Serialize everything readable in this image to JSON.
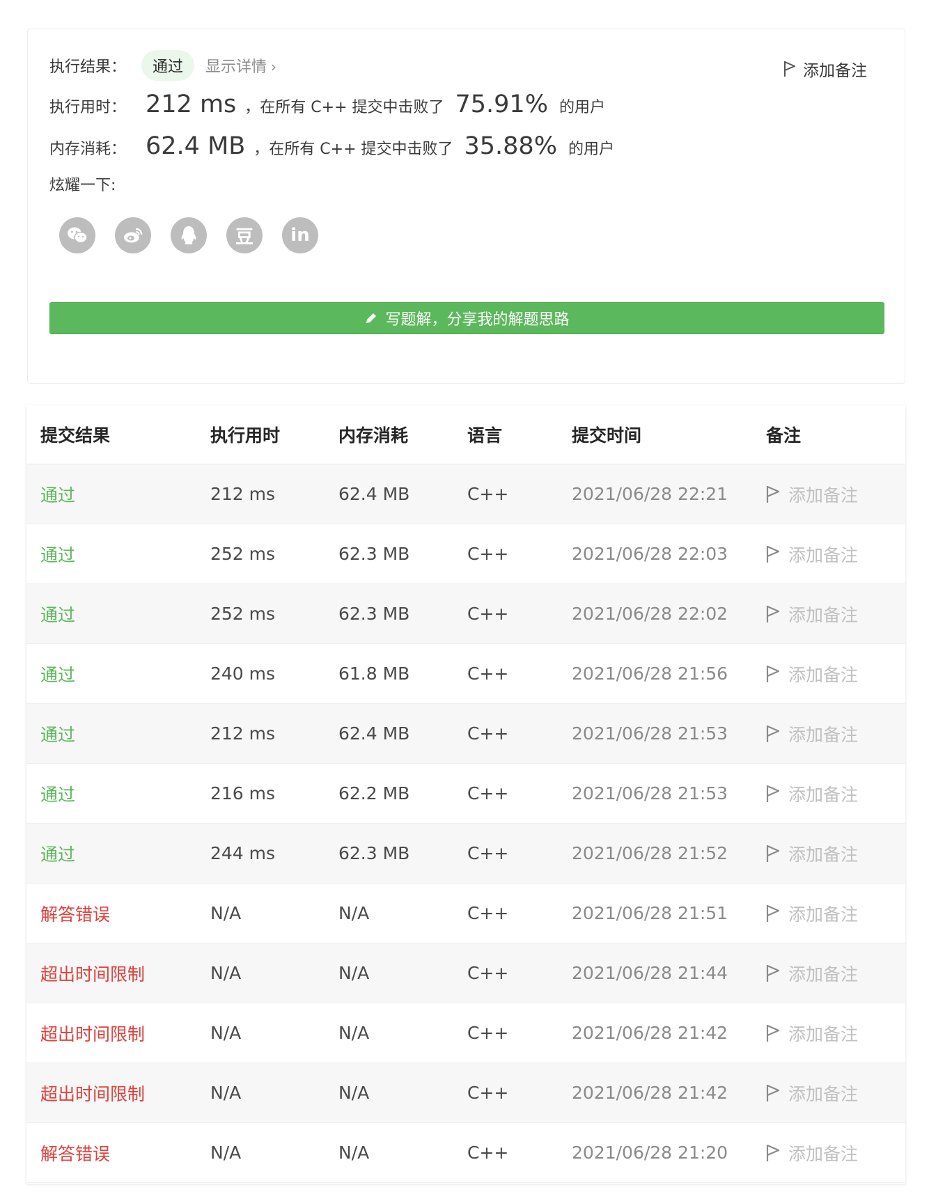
{
  "result": {
    "label": "执行结果：",
    "status": "通过",
    "details": "显示详情",
    "add_note": "添加备注"
  },
  "runtime": {
    "label": "执行用时：",
    "value": "212 ms",
    "text": "，在所有 C++ 提交中击败了",
    "pct": "75.91%",
    "suffix": "的用户"
  },
  "memory": {
    "label": "内存消耗：",
    "value": "62.4 MB",
    "text": "，在所有 C++ 提交中击败了",
    "pct": "35.88%",
    "suffix": "的用户"
  },
  "share": {
    "label": "炫耀一下:",
    "icons": [
      "wechat-icon",
      "weibo-icon",
      "qq-icon",
      "douban-icon",
      "linkedin-icon"
    ],
    "douban_glyph": "豆",
    "linkedin_glyph": "in"
  },
  "write_solution": "写题解，分享我的解题思路",
  "table": {
    "headers": [
      "提交结果",
      "执行用时",
      "内存消耗",
      "语言",
      "提交时间",
      "备注"
    ],
    "rows": [
      {
        "status": "通过",
        "ok": true,
        "time": "212 ms",
        "mem": "62.4 MB",
        "lang": "C++",
        "date": "2021/06/28 22:21",
        "note": "添加备注"
      },
      {
        "status": "通过",
        "ok": true,
        "time": "252 ms",
        "mem": "62.3 MB",
        "lang": "C++",
        "date": "2021/06/28 22:03",
        "note": "添加备注"
      },
      {
        "status": "通过",
        "ok": true,
        "time": "252 ms",
        "mem": "62.3 MB",
        "lang": "C++",
        "date": "2021/06/28 22:02",
        "note": "添加备注"
      },
      {
        "status": "通过",
        "ok": true,
        "time": "240 ms",
        "mem": "61.8 MB",
        "lang": "C++",
        "date": "2021/06/28 21:56",
        "note": "添加备注"
      },
      {
        "status": "通过",
        "ok": true,
        "time": "212 ms",
        "mem": "62.4 MB",
        "lang": "C++",
        "date": "2021/06/28 21:53",
        "note": "添加备注"
      },
      {
        "status": "通过",
        "ok": true,
        "time": "216 ms",
        "mem": "62.2 MB",
        "lang": "C++",
        "date": "2021/06/28 21:53",
        "note": "添加备注"
      },
      {
        "status": "通过",
        "ok": true,
        "time": "244 ms",
        "mem": "62.3 MB",
        "lang": "C++",
        "date": "2021/06/28 21:52",
        "note": "添加备注"
      },
      {
        "status": "解答错误",
        "ok": false,
        "time": "N/A",
        "mem": "N/A",
        "lang": "C++",
        "date": "2021/06/28 21:51",
        "note": "添加备注"
      },
      {
        "status": "超出时间限制",
        "ok": false,
        "time": "N/A",
        "mem": "N/A",
        "lang": "C++",
        "date": "2021/06/28 21:44",
        "note": "添加备注"
      },
      {
        "status": "超出时间限制",
        "ok": false,
        "time": "N/A",
        "mem": "N/A",
        "lang": "C++",
        "date": "2021/06/28 21:42",
        "note": "添加备注"
      },
      {
        "status": "超出时间限制",
        "ok": false,
        "time": "N/A",
        "mem": "N/A",
        "lang": "C++",
        "date": "2021/06/28 21:42",
        "note": "添加备注"
      },
      {
        "status": "解答错误",
        "ok": false,
        "time": "N/A",
        "mem": "N/A",
        "lang": "C++",
        "date": "2021/06/28 21:20",
        "note": "添加备注"
      }
    ]
  }
}
